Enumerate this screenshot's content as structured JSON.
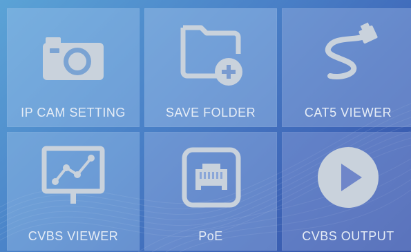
{
  "menu": {
    "tiles": [
      {
        "label": "IP CAM SETTING",
        "icon": "camera-icon"
      },
      {
        "label": "SAVE FOLDER",
        "icon": "folder-add-icon"
      },
      {
        "label": "CAT5 VIEWER",
        "icon": "network-cable-icon"
      },
      {
        "label": "CVBS VIEWER",
        "icon": "monitor-chart-icon"
      },
      {
        "label": "PoE",
        "icon": "ethernet-port-icon"
      },
      {
        "label": "CVBS OUTPUT",
        "icon": "play-circle-icon"
      }
    ]
  },
  "colors": {
    "icon": "#c9d2dc",
    "label": "#e6edf6",
    "background_start": "#5ba3d6",
    "background_end": "#3450a6"
  }
}
